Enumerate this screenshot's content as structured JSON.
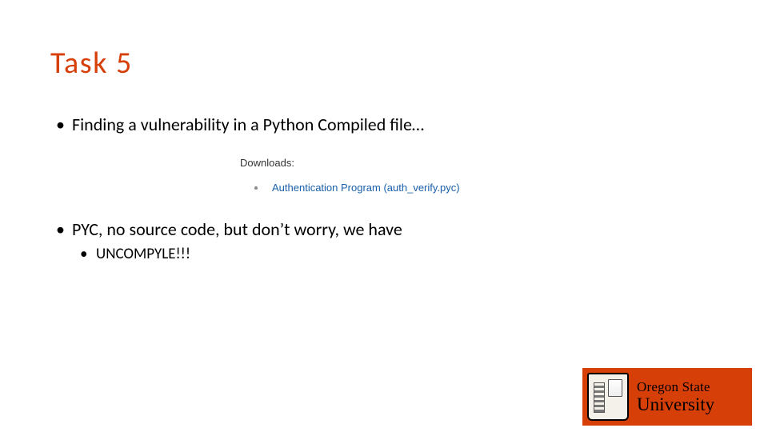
{
  "accent_color": "#d73f09",
  "title": "Task 5",
  "bullets": {
    "b1": "Finding a vulnerability in a Python Compiled file…",
    "b3": "PYC, no source  code, but don’t worry, we have",
    "b4": "UNCOMPYLE!!!"
  },
  "downloads": {
    "label": "Downloads:",
    "item": "Authentication Program (auth_verify.pyc)"
  },
  "logo": {
    "line1": "Oregon State",
    "line2": "University"
  },
  "bullet_char": "•"
}
